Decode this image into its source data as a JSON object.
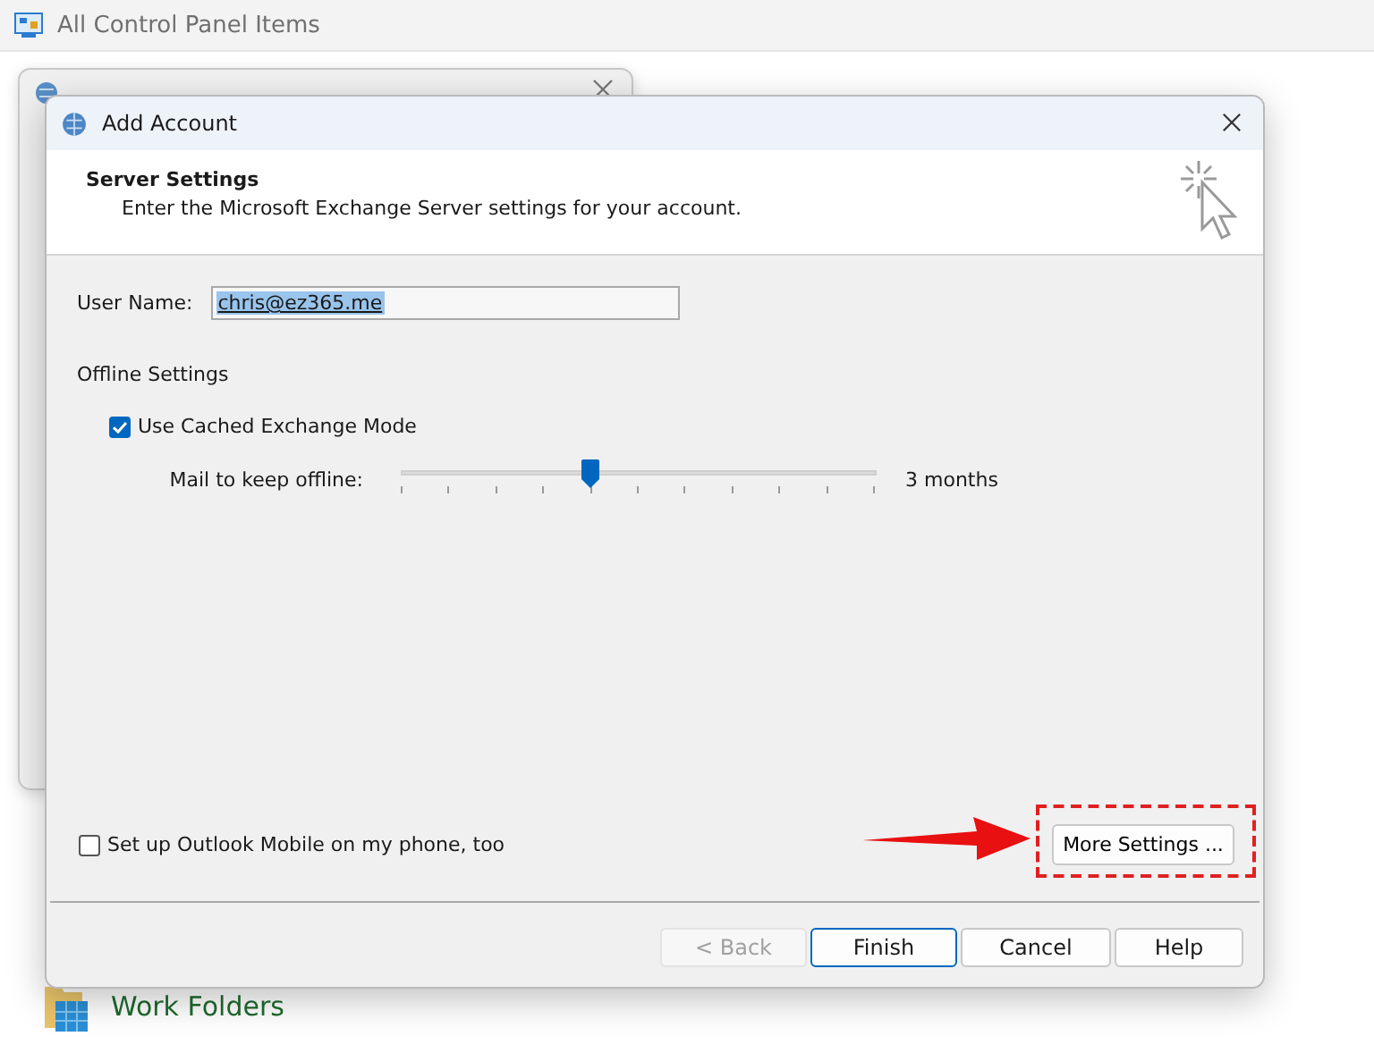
{
  "background_window": {
    "title": "All Control Panel Items"
  },
  "dialog": {
    "title": "Add Account",
    "header": {
      "title": "Server Settings",
      "subtitle": "Enter the Microsoft Exchange Server settings for your account."
    },
    "user_name": {
      "label": "User Name:",
      "value": "chris@ez365.me",
      "selected": true
    },
    "offline": {
      "heading": "Offline Settings",
      "cached_mode": {
        "label": "Use Cached Exchange Mode",
        "checked": true
      },
      "slider": {
        "label": "Mail to keep offline:",
        "level": 0.4,
        "reading": "3 months"
      }
    },
    "mobile": {
      "label": "Set up Outlook Mobile on my phone, too",
      "checked": false
    },
    "more_settings": {
      "label": "More Settings ...",
      "highlighted": true
    },
    "buttons": [
      {
        "label": "< Back",
        "disabled": true,
        "default": false
      },
      {
        "label": "Finish",
        "disabled": false,
        "default": true
      },
      {
        "label": "Cancel",
        "disabled": false,
        "default": false
      },
      {
        "label": "Help",
        "disabled": false,
        "default": false
      }
    ]
  },
  "control_panel_items": [
    {
      "label": "Work Folders"
    }
  ]
}
